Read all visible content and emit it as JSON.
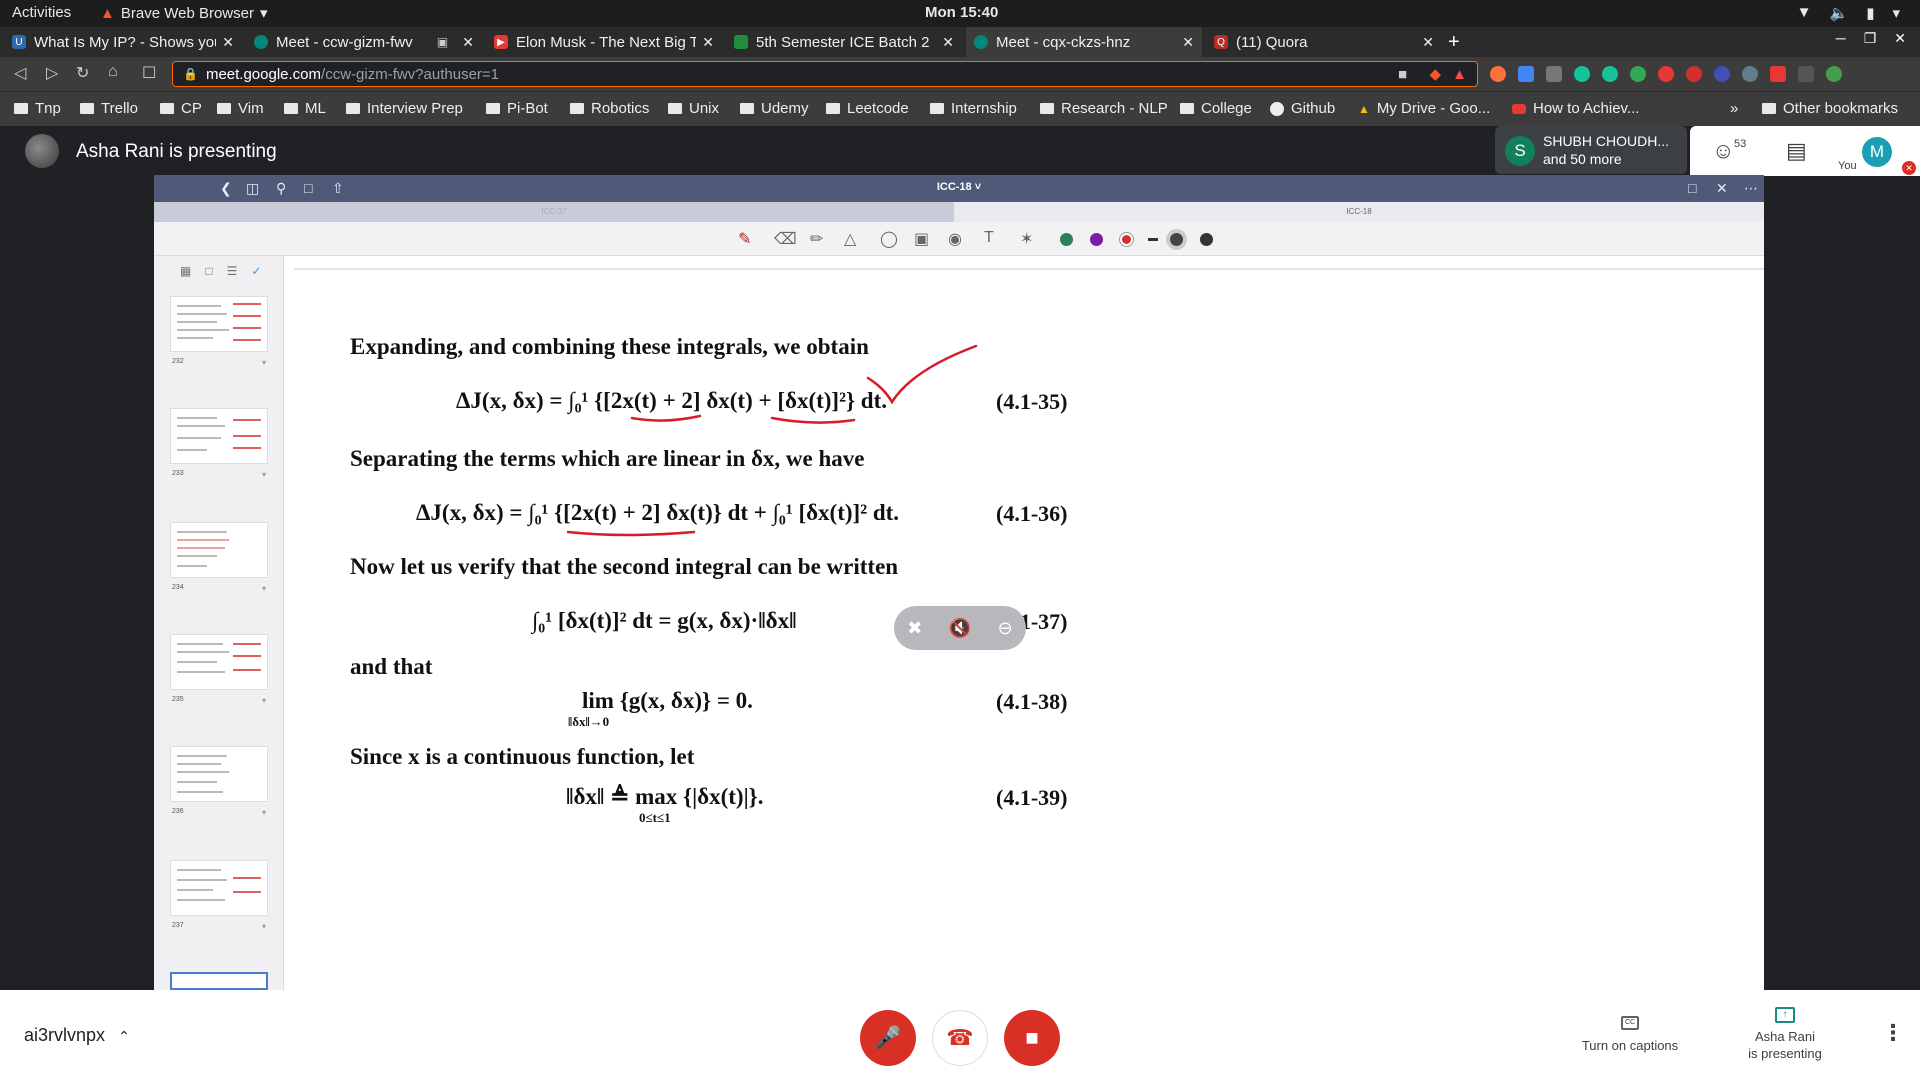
{
  "system": {
    "activities": "Activities",
    "app_name": "Brave Web Browser",
    "clock": "Mon 15:40"
  },
  "tabs": [
    {
      "title": "What Is My IP? - Shows your",
      "fav_color": "#2b6cb0"
    },
    {
      "title": "Meet - ccw-gizm-fwv",
      "fav_color": "#00897b"
    },
    {
      "title": "Elon Musk - The Next Big T",
      "fav_color": "#e53935"
    },
    {
      "title": "5th Semester ICE Batch 2",
      "fav_color": "#1e8e3e"
    },
    {
      "title": "Meet - cqx-ckzs-hnz",
      "fav_color": "#00897b"
    },
    {
      "title": "(11) Quora",
      "fav_color": "#b92b27"
    }
  ],
  "address": {
    "host": "meet.google.com",
    "path": "/ccw-gizm-fwv?authuser=1"
  },
  "bookmarks": [
    "Tnp",
    "Trello",
    "CP",
    "Vim",
    "ML",
    "Interview Prep",
    "Pi-Bot",
    "Robotics",
    "Unix",
    "Udemy",
    "Leetcode",
    "Internship",
    "Research - NLP",
    "College",
    "Github",
    "My Drive - Goo...",
    "How to Achiev...",
    "»",
    "Other bookmarks"
  ],
  "meet": {
    "presenting_title": "Asha Rani is presenting",
    "participant_initial": "S",
    "participant_name": "SHUBH CHOUDH...",
    "participant_more": "and 50 more",
    "participant_count": "53",
    "me_initial": "M",
    "me_label": "You",
    "meeting_code": "ai3rvlvnpx",
    "captions_label": "Turn on captions",
    "presenting_label_1": "Asha Rani",
    "presenting_label_2": "is presenting"
  },
  "viewer": {
    "doc_title": "ICC-18 ˅",
    "tab_left": "ICC-37",
    "tab_right": "ICC-18",
    "thumb_pages": [
      "232",
      "233",
      "234",
      "235",
      "236",
      "237"
    ],
    "pen_colors": [
      "#2e7d5b",
      "#7b1fa2",
      "#d32f2f"
    ]
  },
  "document": {
    "line1": "Expanding, and combining these integrals, we obtain",
    "eq35": "ΔJ(x, δx) = ∫₀¹ {[2x(t) + 2] δx(t) + [δx(t)]²} dt.",
    "eq35_num": "(4.1-35)",
    "line2": "Separating the terms which are linear in δx, we have",
    "eq36": "ΔJ(x, δx) = ∫₀¹ {[2x(t) + 2] δx(t)} dt + ∫₀¹ [δx(t)]² dt.",
    "eq36_num": "(4.1-36)",
    "line3": "Now let us verify that the second integral can be written",
    "eq37": "∫₀¹ [δx(t)]² dt = g(x, δx)·‖δx‖",
    "eq37_num": "(4.1-37)",
    "line4": "and that",
    "eq38": "lim {g(x, δx)} = 0.",
    "eq38_sub": "‖δx‖→0",
    "eq38_num": "(4.1-38)",
    "line5": "Since x is a continuous function, let",
    "eq39": "‖δx‖ ≜ max {|δx(t)|}.",
    "eq39_sub": "0≤t≤1",
    "eq39_num": "(4.1-39)"
  }
}
